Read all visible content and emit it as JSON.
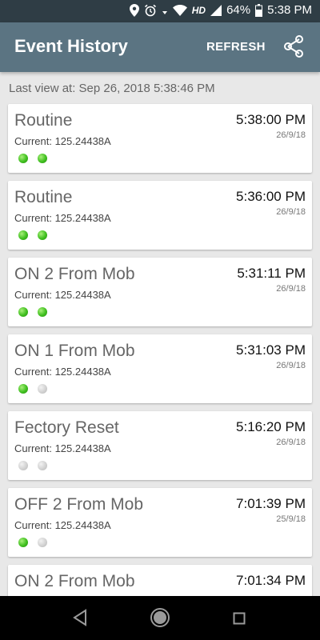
{
  "status_bar": {
    "battery_percent": "64%",
    "time": "5:38 PM",
    "network_label": "HD"
  },
  "app_bar": {
    "title": "Event History",
    "refresh_label": "REFRESH",
    "share_icon": "share-icon"
  },
  "last_view": "Last view at: Sep 26, 2018 5:38:46 PM",
  "events": [
    {
      "name": "Routine",
      "current": "Current: 125.24438A",
      "time": "5:38:00 PM",
      "date": "26/9/18",
      "leds": [
        true,
        true
      ]
    },
    {
      "name": "Routine",
      "current": "Current: 125.24438A",
      "time": "5:36:00 PM",
      "date": "26/9/18",
      "leds": [
        true,
        true
      ]
    },
    {
      "name": "ON 2 From Mob",
      "current": "Current: 125.24438A",
      "time": "5:31:11 PM",
      "date": "26/9/18",
      "leds": [
        true,
        true
      ]
    },
    {
      "name": "ON 1 From Mob",
      "current": "Current: 125.24438A",
      "time": "5:31:03 PM",
      "date": "26/9/18",
      "leds": [
        true,
        false
      ]
    },
    {
      "name": "Fectory Reset",
      "current": "Current: 125.24438A",
      "time": "5:16:20 PM",
      "date": "26/9/18",
      "leds": [
        false,
        false
      ]
    },
    {
      "name": "OFF 2 From Mob",
      "current": "Current: 125.24438A",
      "time": "7:01:39 PM",
      "date": "25/9/18",
      "leds": [
        true,
        false
      ]
    },
    {
      "name": "ON 2 From Mob",
      "current": "",
      "time": "7:01:34 PM",
      "date": "",
      "leds": []
    }
  ],
  "colors": {
    "app_bar": "#5b7482",
    "status_bar": "#2f3d45",
    "led_on": "#3fbf1f",
    "led_off": "#cfcfcf"
  }
}
